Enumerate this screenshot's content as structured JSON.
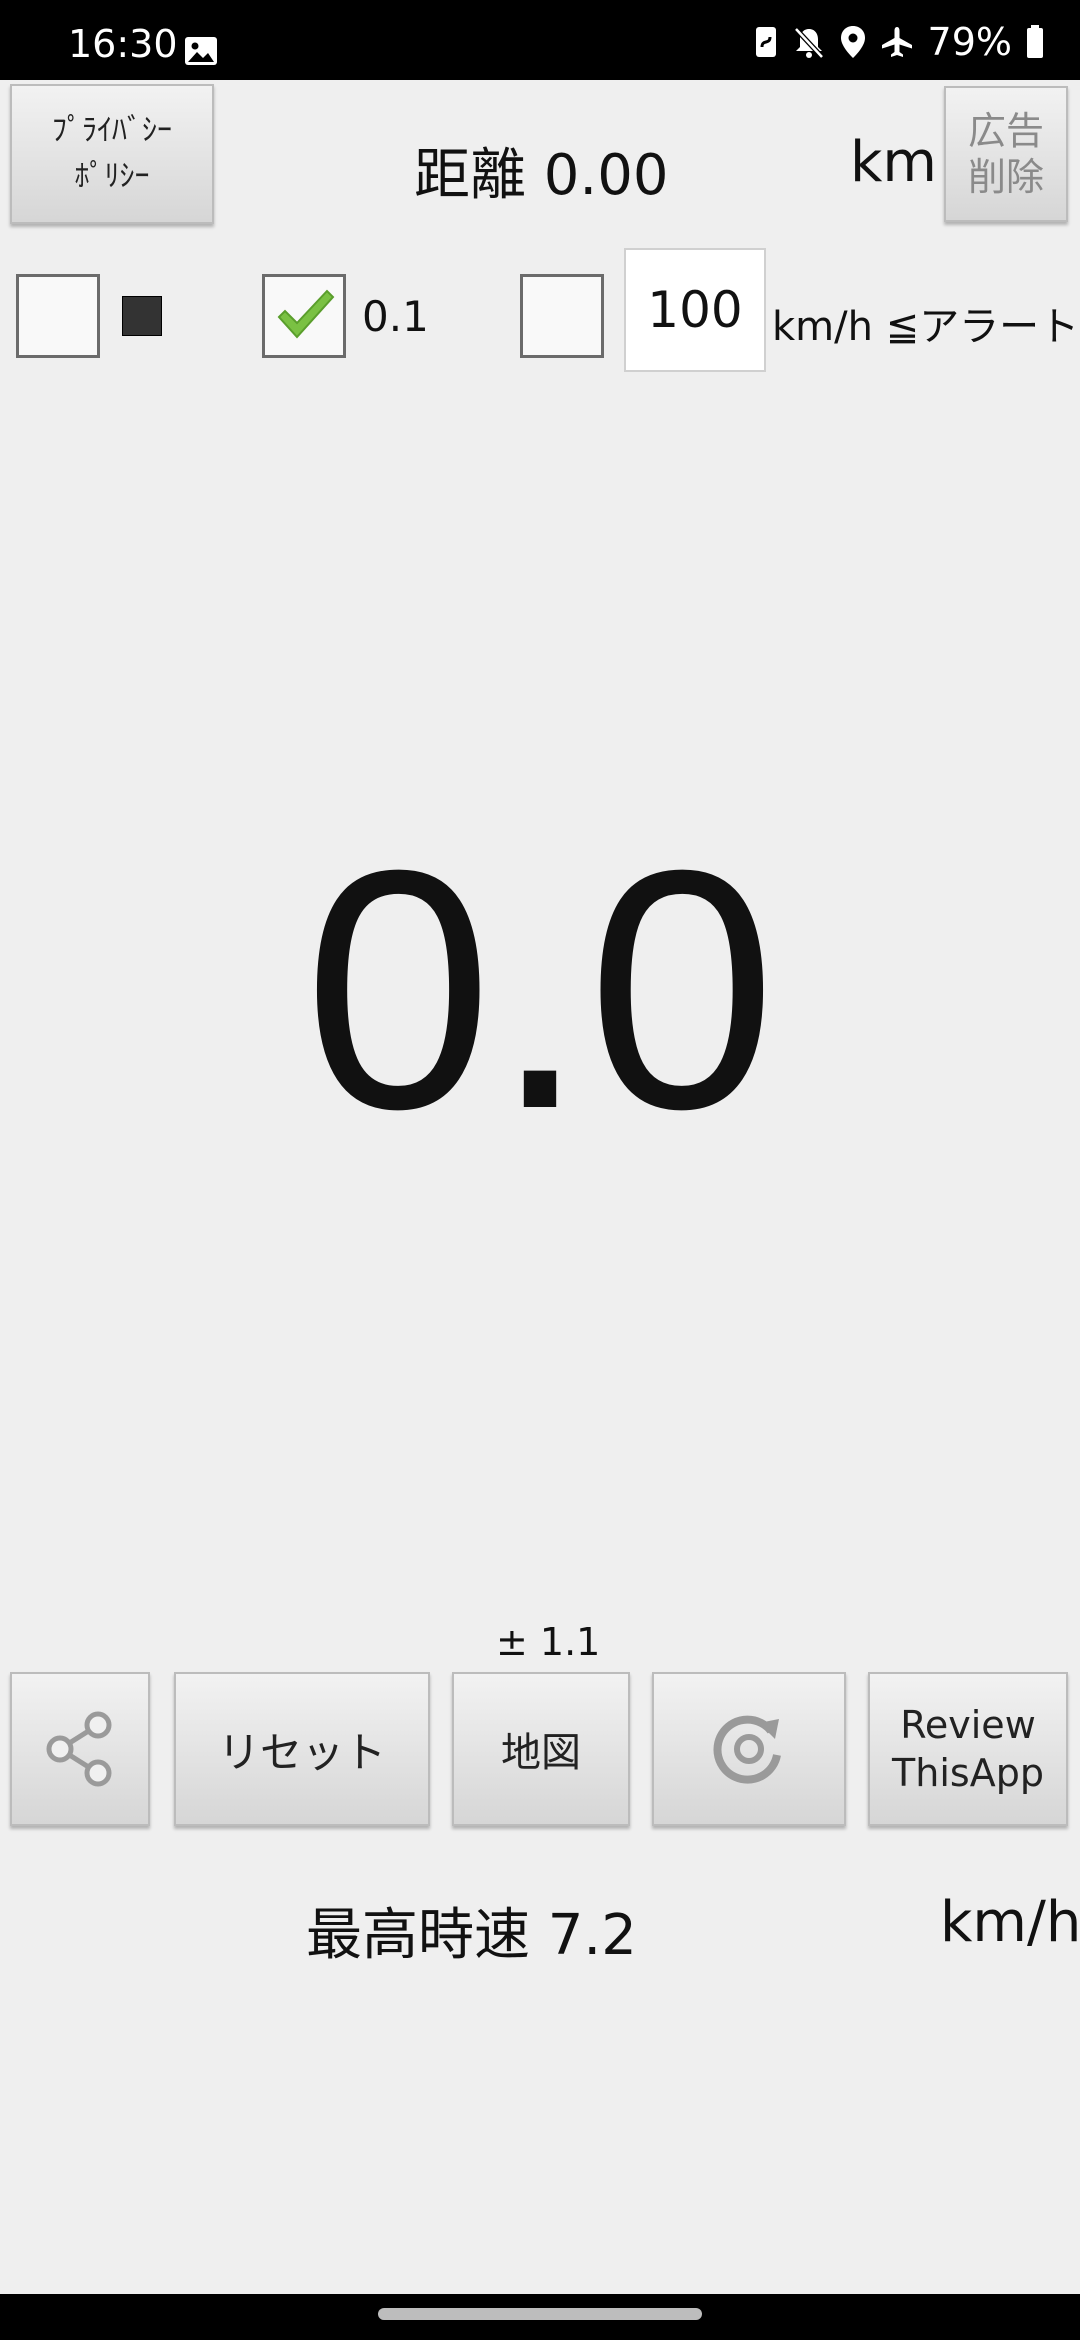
{
  "status_bar": {
    "time": "16:30",
    "battery": "79%",
    "icons": [
      "gallery-icon",
      "nfc-icon",
      "mute-icon",
      "location-icon",
      "airplane-icon",
      "battery-icon"
    ]
  },
  "header": {
    "privacy_line1": "ﾌﾟﾗｲﾊﾞｼｰ",
    "privacy_line2": "ﾎﾟﾘｼｰ",
    "distance": "距離 0.00",
    "distance_unit": "km",
    "remove_ads_line1": "広告",
    "remove_ads_line2": "削除"
  },
  "settings": {
    "checkbox_dark_mode_checked": false,
    "checkbox_interval_checked": true,
    "interval_value": "0.1",
    "checkbox_alert_checked": false,
    "alert_speed": "100",
    "alert_label": "km/h ≦アラート"
  },
  "speed": {
    "value": "0.0"
  },
  "accuracy": "± 1.1",
  "buttons": {
    "reset": "リセット",
    "map": "地図",
    "review_line1": "Review",
    "review_line2": "ThisApp"
  },
  "max_speed": {
    "label": "最高時速 7.2",
    "unit": "km/h"
  },
  "colors": {
    "background": "#efefef",
    "checkmark": "#7ac143",
    "status_bar": "#000000"
  }
}
